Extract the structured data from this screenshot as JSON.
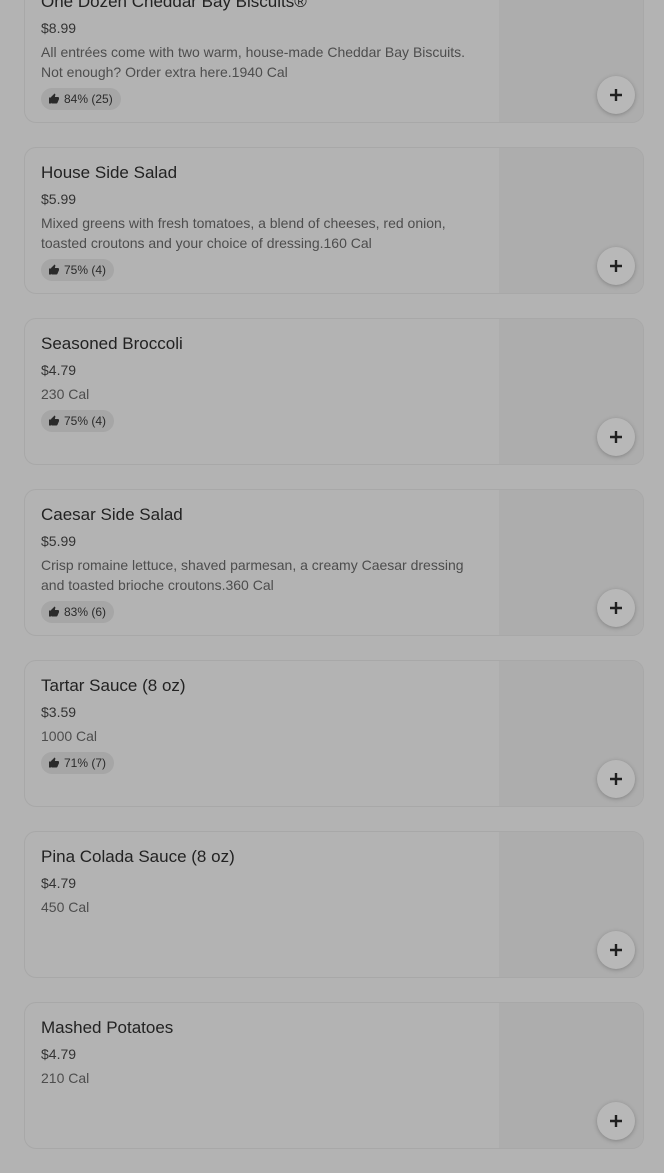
{
  "menu": {
    "items": [
      {
        "name": "One Dozen Cheddar Bay Biscuits®",
        "price": "$8.99",
        "description": "All entrées come with two warm, house-made Cheddar Bay Biscuits. Not enough? Order extra here.1940 Cal",
        "rating": "84% (25)"
      },
      {
        "name": "House Side Salad",
        "price": "$5.99",
        "description": "Mixed greens with fresh tomatoes, a blend of cheeses, red onion, toasted croutons and your choice of dressing.160 Cal",
        "rating": "75% (4)"
      },
      {
        "name": "Seasoned Broccoli",
        "price": "$4.79",
        "description": "230 Cal",
        "rating": "75% (4)"
      },
      {
        "name": "Caesar Side Salad",
        "price": "$5.99",
        "description": "Crisp romaine lettuce, shaved parmesan, a creamy Caesar dressing and toasted brioche croutons.360 Cal",
        "rating": "83% (6)"
      },
      {
        "name": "Tartar Sauce (8 oz)",
        "price": "$3.59",
        "description": "1000 Cal",
        "rating": "71% (7)"
      },
      {
        "name": "Pina Colada Sauce (8 oz)",
        "price": "$4.79",
        "description": "450 Cal",
        "rating": ""
      },
      {
        "name": "Mashed Potatoes",
        "price": "$4.79",
        "description": "210 Cal",
        "rating": ""
      }
    ],
    "icons": {
      "rating": "thumbs-up-icon",
      "add": "plus-icon"
    }
  }
}
